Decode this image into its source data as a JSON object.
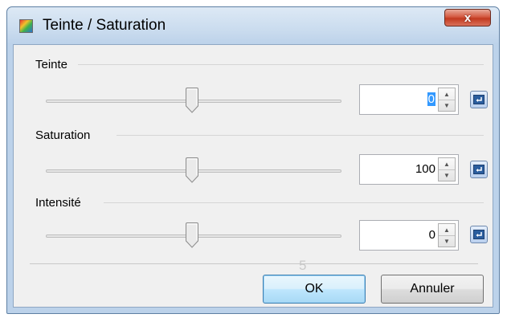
{
  "window": {
    "title": "Teinte / Saturation",
    "close_glyph": "x"
  },
  "controls": [
    {
      "label": "Teinte",
      "value": "0",
      "value_selected": true,
      "slider_position": 0.5
    },
    {
      "label": "Saturation",
      "value": "100",
      "value_selected": false,
      "slider_position": 0.5
    },
    {
      "label": "Intensité",
      "value": "0",
      "value_selected": false,
      "slider_position": 0.5
    }
  ],
  "footer": {
    "ghost_text": "5",
    "ok_label": "OK",
    "cancel_label": "Annuler"
  },
  "icons": {
    "app": "color-palette-icon",
    "reset": "reset-arrow-icon",
    "spin": "spin-up-down-icon"
  },
  "colors": {
    "title_gradient_top": "#dde9f5",
    "close_red": "#c23a20",
    "selection_blue": "#3399ff",
    "reset_blue": "#2a5d9e"
  }
}
